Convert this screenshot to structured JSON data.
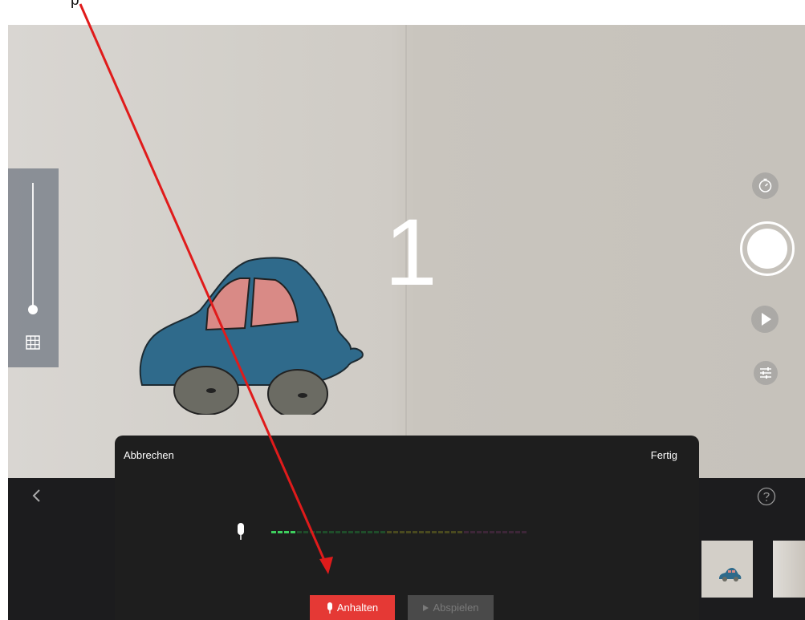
{
  "annotation": {
    "partial_text": "p"
  },
  "recording_dialog": {
    "cancel_label": "Abbrechen",
    "done_label": "Fertig",
    "stop_label": "Anhalten",
    "play_label": "Abspielen"
  },
  "camera": {
    "countdown": "1"
  },
  "exposure_slider": {
    "level": 0.0
  },
  "audio_meter": {
    "active_segments": 4,
    "total_segments": 40
  },
  "icons": {
    "grid": "grid-icon",
    "timer": "timer-icon",
    "shutter": "shutter-button",
    "play": "play-icon",
    "settings": "sliders-icon",
    "back": "chevron-left-icon",
    "help": "question-mark-icon",
    "mic": "microphone-icon"
  },
  "colors": {
    "stop_button": "#e53935",
    "arrow": "#e01b1b",
    "meter_active": "#3ecf5e"
  }
}
